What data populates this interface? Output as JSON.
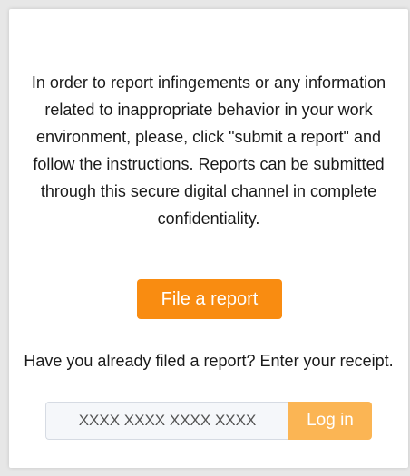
{
  "intro_text": "In order to report infingements or any information related to inappropriate behavior in your work environment, please, click \"submit a report\" and follow the instructions. Reports can be submitted through this secure digital channel in complete confidentiality.",
  "file_report": {
    "label": "File a report",
    "color": "#f98c11"
  },
  "receipt": {
    "prompt": "Have you already filed a report? Enter your receipt.",
    "placeholder": "XXXX XXXX XXXX XXXX",
    "login_label": "Log in",
    "login_color": "#fbb554"
  }
}
